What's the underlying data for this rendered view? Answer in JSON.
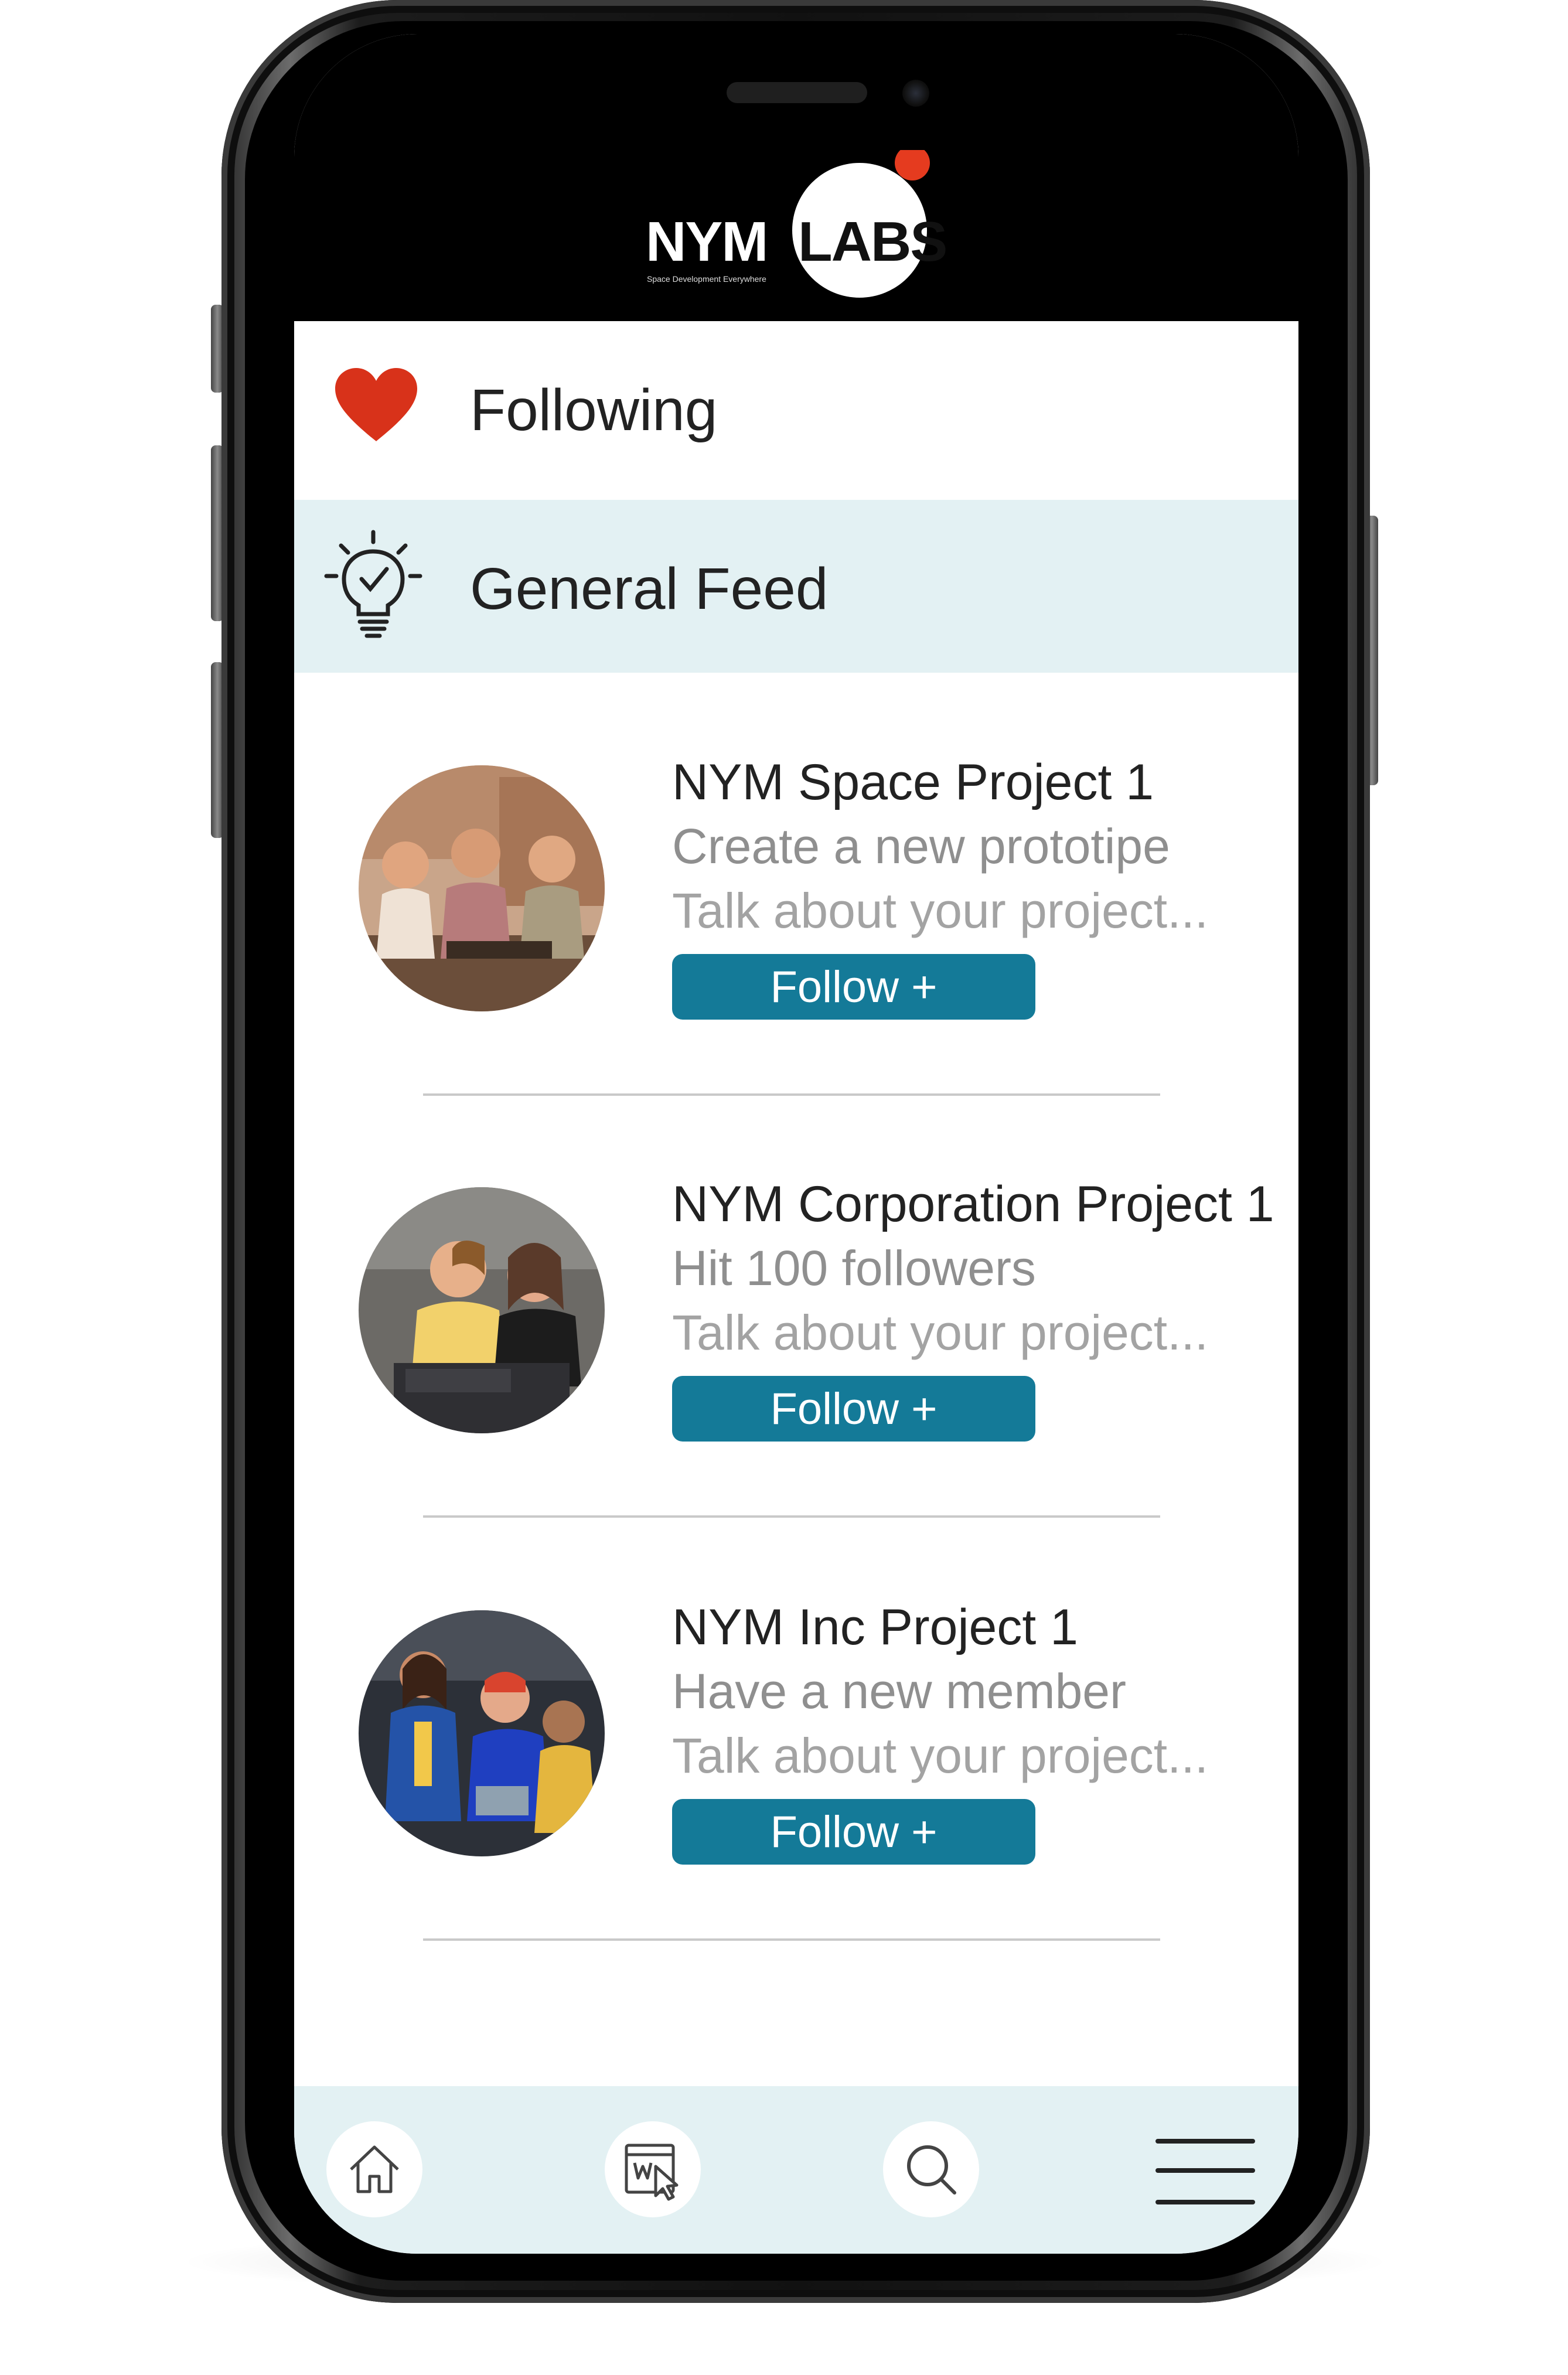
{
  "app": {
    "logo_left": "NYM",
    "logo_right": "LABS",
    "logo_tagline": "Space Development Everywhere",
    "accent_color": "#147a98",
    "brand_dot_color": "#e53b1f"
  },
  "menu": {
    "following_label": "Following",
    "following_icon": "heart-icon",
    "feed_label": "General Feed",
    "feed_icon": "lightbulb-icon"
  },
  "feed": {
    "items": [
      {
        "title": "NYM Space Project 1",
        "subtitle": "Create a new prototipe",
        "description": "Talk about your project...",
        "button_label": "Follow +"
      },
      {
        "title": "NYM Corporation Project 1",
        "subtitle": "Hit 100 followers",
        "description": "Talk about your project...",
        "button_label": "Follow +"
      },
      {
        "title": "NYM Inc Project 1",
        "subtitle": "Have a new member",
        "description": "Talk about your project...",
        "button_label": "Follow +"
      }
    ]
  },
  "bottom_nav": {
    "items": [
      "home-icon",
      "browser-click-icon",
      "search-icon",
      "menu-icon"
    ]
  }
}
